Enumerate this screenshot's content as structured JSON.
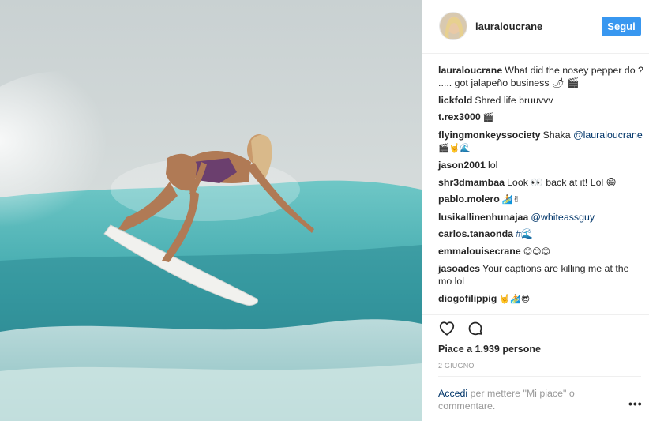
{
  "post": {
    "image_alt": "Surfer riding a turquoise wave"
  },
  "header": {
    "username": "lauraloucrane",
    "follow_label": "Segui"
  },
  "comments": [
    {
      "user": "lauraloucrane",
      "text": "What did the nosey pepper do ? ..... got jalapeño business 🌶 🎬"
    },
    {
      "user": "lickfold",
      "text": "Shred life bruuvvv"
    },
    {
      "user": "t.rex3000",
      "text": "🎬"
    },
    {
      "user": "flyingmonkeyssociety",
      "text": "Shaka",
      "mention": "@lauraloucrane",
      "after": "🎬🤘🌊"
    },
    {
      "user": "jason2001",
      "text": "lol"
    },
    {
      "user": "shr3dmambaa",
      "text": "Look 👀 back at it! Lol 😁"
    },
    {
      "user": "pablo.molero",
      "text": "🏄✌"
    },
    {
      "user": "lusikallinenhunajaa",
      "text": "",
      "mention": "@whiteassguy",
      "after": ""
    },
    {
      "user": "carlos.tanaonda",
      "text": "#🌊"
    },
    {
      "user": "emmalouisecrane",
      "text": "😊😊😊"
    },
    {
      "user": "jasoades",
      "text": "Your captions are killing me at the mo lol"
    },
    {
      "user": "diogofilippig",
      "text": "🤘🏄😎"
    }
  ],
  "actions": {
    "like_icon": "heart-icon",
    "comment_icon": "comment-bubble-icon",
    "likes_text": "Piace a 1.939 persone",
    "date_text": "2 GIUGNO"
  },
  "login": {
    "link_text": "Accedi",
    "rest_text": " per mettere \"Mi piace\" o commentare.",
    "more_label": "•••"
  },
  "colors": {
    "follow_button": "#3897f0",
    "link": "#003569",
    "muted": "#999999"
  }
}
